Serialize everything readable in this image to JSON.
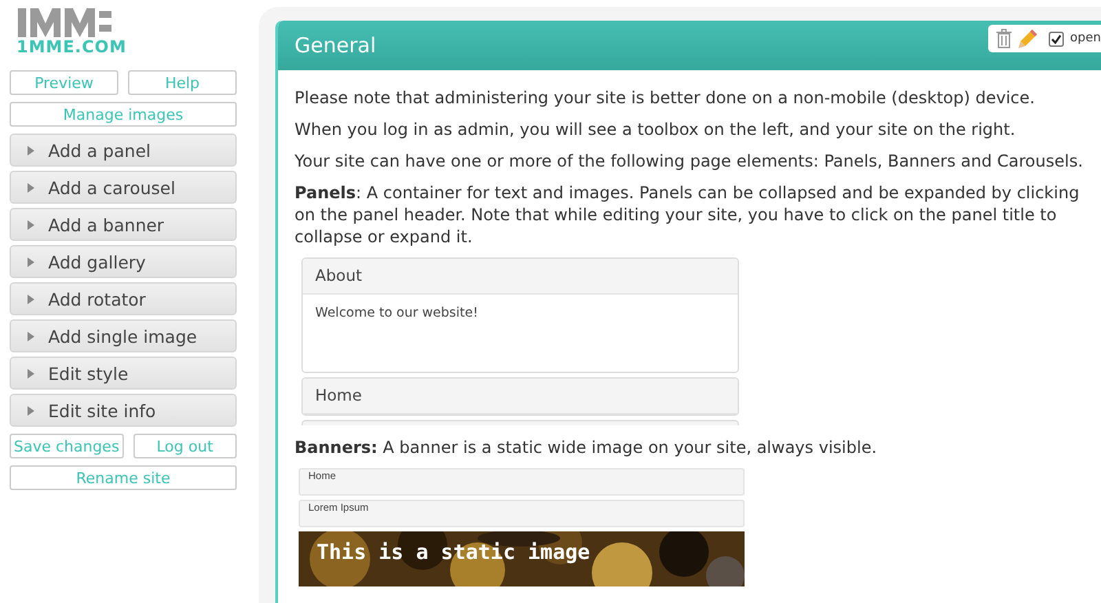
{
  "logo": {
    "site": "1MME.COM"
  },
  "sidebar": {
    "top_buttons": [
      "Preview",
      "Help"
    ],
    "manage_button": "Manage images",
    "menu": [
      "Add a panel",
      "Add a carousel",
      "Add a banner",
      "Add gallery",
      "Add rotator",
      "Add single image",
      "Edit style",
      "Edit site info"
    ],
    "bottom_buttons": [
      "Save changes",
      "Log out"
    ],
    "rename_button": "Rename site"
  },
  "panel": {
    "title": "General",
    "toolbox": {
      "open_checked": true,
      "open_label": "open"
    },
    "paragraphs": [
      "Please note that administering your site is better done on a non-mobile (desktop) device.",
      "When you log in as admin, you will see a toolbox on the left, and your site on the right.",
      "Your site can have one or more of the following page elements: Panels, Banners and Carousels.",
      "**Panels**: A container for text and images. Panels can be collapsed and be expanded by clicking on the panel header. Note that while editing your site, you have to click on the panel title to collapse or expand it."
    ],
    "demo_panels": [
      {
        "title": "About",
        "expanded": true,
        "body": "Welcome to our website!"
      },
      {
        "title": "Home",
        "expanded": false
      }
    ],
    "banners_text": "**Banners:** A banner is a static wide image on your site, always visible.",
    "banner_demo": {
      "nav": [
        "Home",
        "Lorem Ipsum"
      ],
      "caption": "This is a static image"
    }
  }
}
